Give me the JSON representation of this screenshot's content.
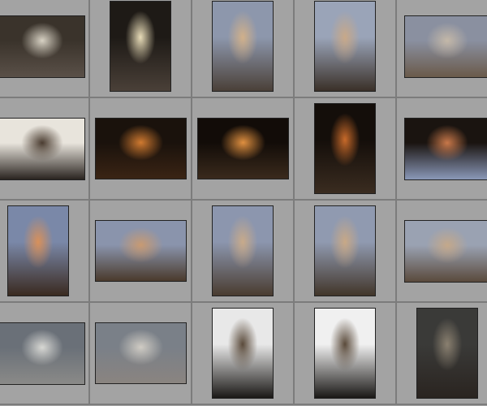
{
  "grid": {
    "columns": 5,
    "background": "#a3a3a3",
    "divider": "#7c7c7c",
    "thumbnails": [
      {
        "orientation": "landscape",
        "top": "#3a332b",
        "bottom": "#5a5048",
        "accent": "#d8d2c4"
      },
      {
        "orientation": "portrait",
        "top": "#1e1a16",
        "bottom": "#4a4038",
        "accent": "#e8dcb8"
      },
      {
        "orientation": "portrait",
        "top": "#8d97ac",
        "bottom": "#4a4038",
        "accent": "#d1b08a"
      },
      {
        "orientation": "portrait",
        "top": "#9aa4b8",
        "bottom": "#3a3028",
        "accent": "#c8a888"
      },
      {
        "orientation": "landscape",
        "top": "#8a90a0",
        "bottom": "#6a5a4a",
        "accent": "#c4b8a8"
      },
      {
        "orientation": "landscape",
        "top": "#e8e4dc",
        "bottom": "#2a2420",
        "accent": "#4a3c30"
      },
      {
        "orientation": "landscape",
        "top": "#1a120c",
        "bottom": "#3a2414",
        "accent": "#d07a30"
      },
      {
        "orientation": "landscape",
        "top": "#120c08",
        "bottom": "#3a2a1c",
        "accent": "#e09040"
      },
      {
        "orientation": "portrait",
        "top": "#140e0a",
        "bottom": "#3a2c20",
        "accent": "#c86a2a"
      },
      {
        "orientation": "landscape",
        "top": "#1a1410",
        "bottom": "#8a98b8",
        "accent": "#c8784a"
      },
      {
        "orientation": "portrait",
        "top": "#7a88a8",
        "bottom": "#3a2a20",
        "accent": "#d8905a"
      },
      {
        "orientation": "landscape",
        "top": "#8a94ac",
        "bottom": "#4a3a2c",
        "accent": "#c89a72"
      },
      {
        "orientation": "portrait",
        "top": "#8c96ae",
        "bottom": "#4a3c30",
        "accent": "#c8aa8a"
      },
      {
        "orientation": "portrait",
        "top": "#909ab0",
        "bottom": "#42362a",
        "accent": "#c8a886"
      },
      {
        "orientation": "landscape",
        "top": "#9aa2b2",
        "bottom": "#5a4a3c",
        "accent": "#c4a88a"
      },
      {
        "orientation": "landscape",
        "top": "#6a7078",
        "bottom": "#8a8a88",
        "accent": "#d8d8d4"
      },
      {
        "orientation": "landscape",
        "top": "#7a8088",
        "bottom": "#8a8480",
        "accent": "#d0ccc4"
      },
      {
        "orientation": "portrait",
        "top": "#e8e8e8",
        "bottom": "#1a1816",
        "accent": "#5a4a3a"
      },
      {
        "orientation": "portrait",
        "top": "#f0f0f0",
        "bottom": "#1a1816",
        "accent": "#5a4a3a"
      },
      {
        "orientation": "portrait",
        "top": "#3a3a38",
        "bottom": "#2a2420",
        "accent": "#8a8070"
      }
    ]
  }
}
